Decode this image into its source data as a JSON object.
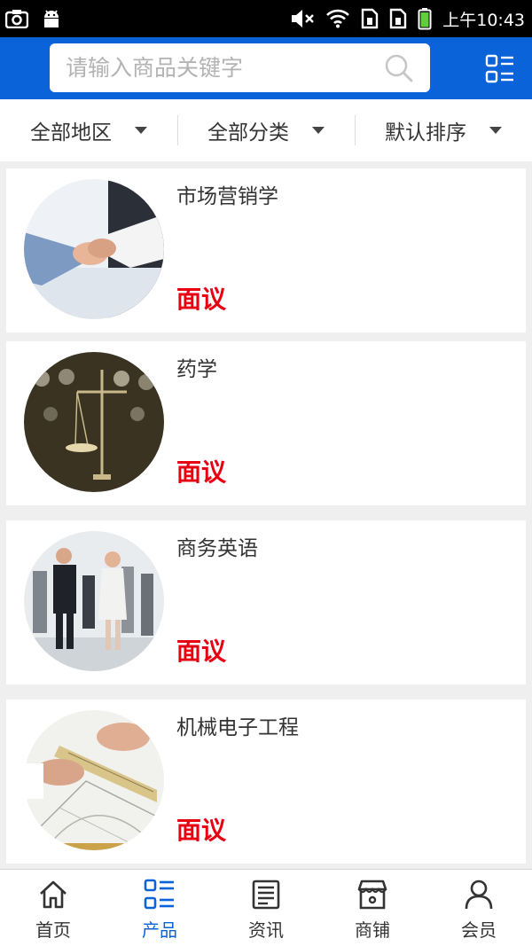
{
  "status_bar": {
    "time": "上午10:43"
  },
  "search": {
    "placeholder": "请输入商品关键字",
    "value": ""
  },
  "filters": [
    {
      "label": "全部地区"
    },
    {
      "label": "全部分类"
    },
    {
      "label": "默认排序"
    }
  ],
  "products": [
    {
      "title": "市场营销学",
      "price": "面议",
      "image": "handshake"
    },
    {
      "title": "药学",
      "price": "面议",
      "image": "balance-scale"
    },
    {
      "title": "商务英语",
      "price": "面议",
      "image": "business-people"
    },
    {
      "title": "机械电子工程",
      "price": "面议",
      "image": "engineering-drawing"
    }
  ],
  "bottom_nav": [
    {
      "label": "首页",
      "icon": "home-icon",
      "active": false
    },
    {
      "label": "产品",
      "icon": "list-grid-icon",
      "active": true
    },
    {
      "label": "资讯",
      "icon": "news-icon",
      "active": false
    },
    {
      "label": "商铺",
      "icon": "store-icon",
      "active": false
    },
    {
      "label": "会员",
      "icon": "user-icon",
      "active": false
    }
  ],
  "colors": {
    "brand_blue": "#0a63d8",
    "price_red": "#e60012",
    "background": "#efefef"
  }
}
